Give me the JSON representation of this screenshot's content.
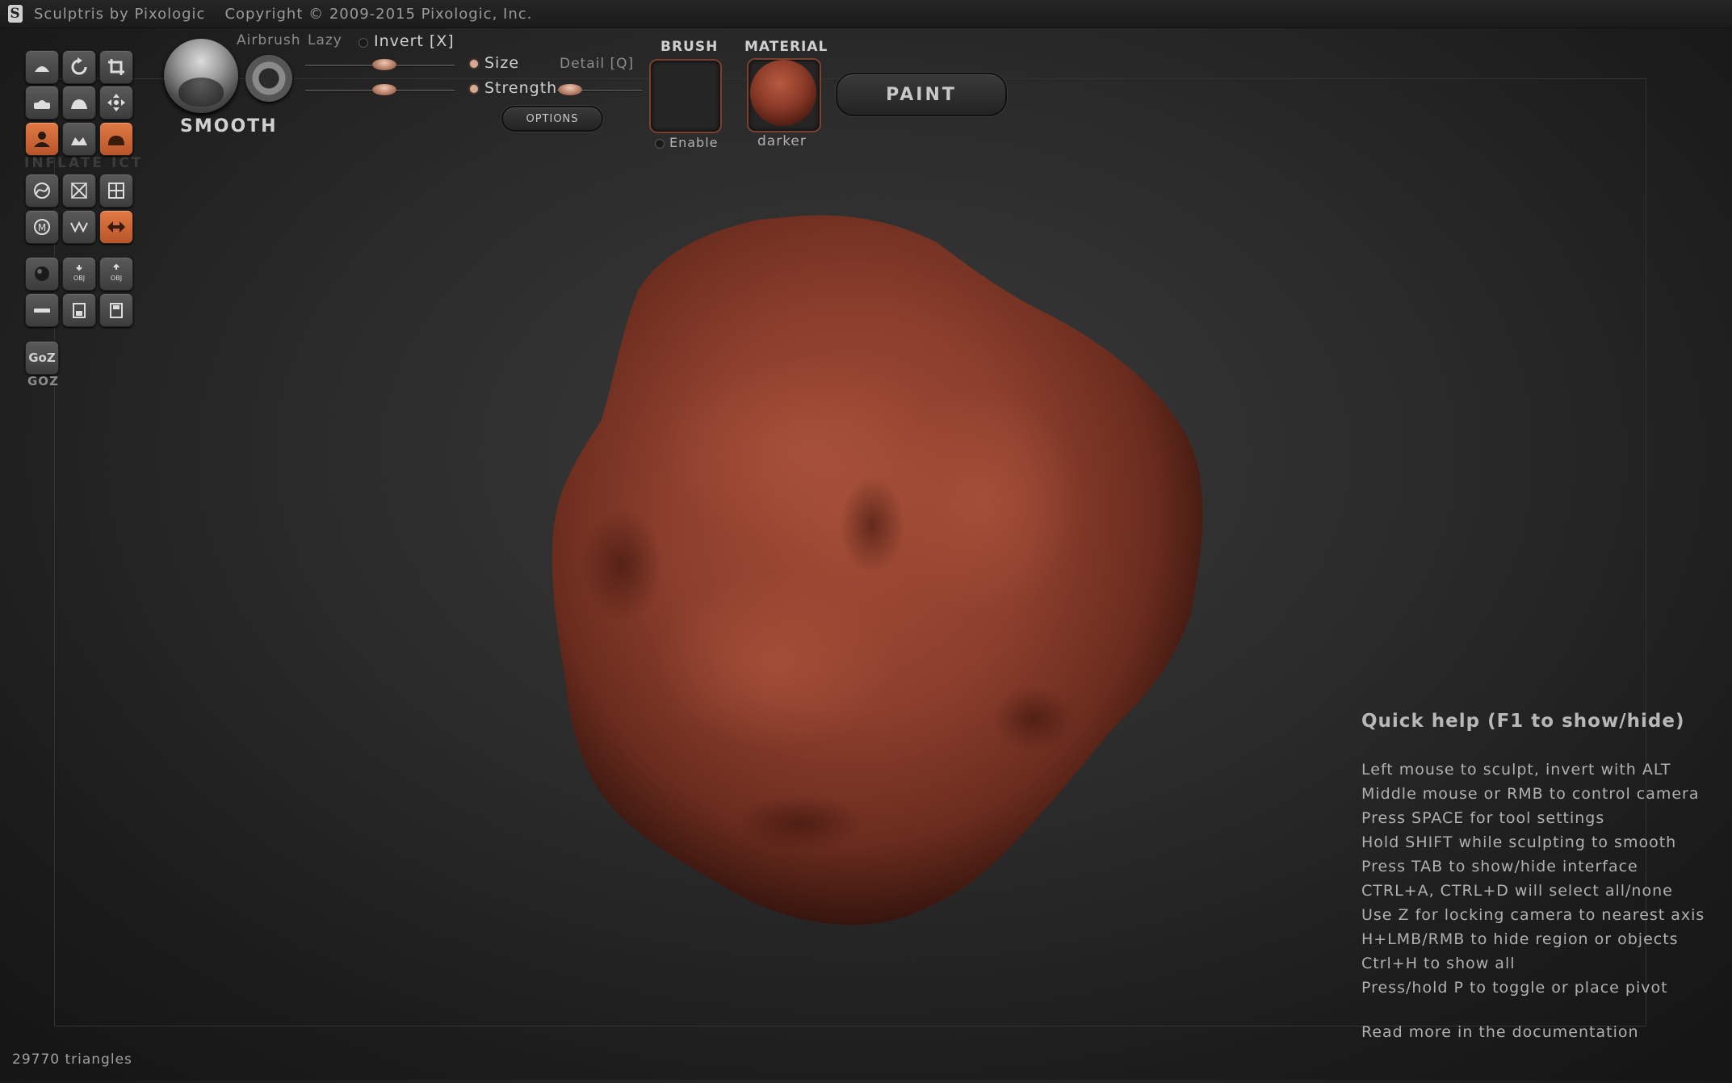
{
  "window": {
    "title": "Sculptris by Pixologic",
    "copyright": "Copyright © 2009-2015 Pixologic, Inc.",
    "logo_glyph": "S"
  },
  "colors": {
    "accent_orange": "#d2693a",
    "model_clay": "#8a3e2c"
  },
  "left_toolbar": {
    "tools": [
      {
        "icon": "draw-icon",
        "active": false
      },
      {
        "icon": "rotate-icon",
        "active": false
      },
      {
        "icon": "scale-icon",
        "active": false
      },
      {
        "icon": "flatten-icon",
        "active": false
      },
      {
        "icon": "crease-icon",
        "active": false
      },
      {
        "icon": "grab-move-icon",
        "active": false
      },
      {
        "icon": "inflate-icon",
        "active": true
      },
      {
        "icon": "pinch-icon",
        "active": false
      },
      {
        "icon": "smooth-icon",
        "active": true
      },
      {
        "icon": "reduce-brush-icon",
        "active": false
      },
      {
        "icon": "reduce-selection-icon",
        "active": false
      },
      {
        "icon": "subdivide-all-icon",
        "active": false
      },
      {
        "icon": "mask-icon",
        "active": false
      },
      {
        "icon": "wireframe-icon",
        "active": false
      },
      {
        "icon": "symmetry-icon",
        "active": true
      },
      {
        "icon": "new-sphere-icon",
        "active": false
      },
      {
        "icon": "import-obj-icon",
        "active": false
      },
      {
        "icon": "export-obj-icon",
        "active": false
      },
      {
        "icon": "new-plane-icon",
        "active": false
      },
      {
        "icon": "open-file-icon",
        "active": false
      },
      {
        "icon": "save-file-icon",
        "active": false
      }
    ],
    "faint_label": "INFLATE ICT",
    "goz_button": "GoZ",
    "goz_label": "GOZ"
  },
  "brush": {
    "name": "SMOOTH",
    "airbrush_label": "Airbrush",
    "lazy_label": "Lazy",
    "invert_label": "Invert [X]",
    "size_label": "Size",
    "strength_label": "Strength",
    "detail_label": "Detail [Q]",
    "options_label": "OPTIONS",
    "size_value": 0.53,
    "strength_value": 0.53,
    "detail_value": 0.15
  },
  "brush_panel": {
    "title": "BRUSH",
    "enable_label": "Enable"
  },
  "material_panel": {
    "title": "MATERIAL",
    "material_name": "darker"
  },
  "mode_button": {
    "label": "PAINT"
  },
  "quick_help": {
    "title": "Quick help (F1 to show/hide)",
    "lines": [
      "Left mouse to sculpt, invert with ALT",
      "Middle mouse or RMB to control camera",
      "Press SPACE for tool settings",
      "Hold SHIFT while sculpting to smooth",
      "Press TAB to show/hide interface",
      "CTRL+A, CTRL+D will select all/none",
      "Use Z for locking camera to nearest axis",
      "H+LMB/RMB to hide region or objects",
      "Ctrl+H to show all",
      "Press/hold P to toggle or place pivot"
    ],
    "more": "Read more in the documentation"
  },
  "status": {
    "triangles": "29770 triangles"
  }
}
